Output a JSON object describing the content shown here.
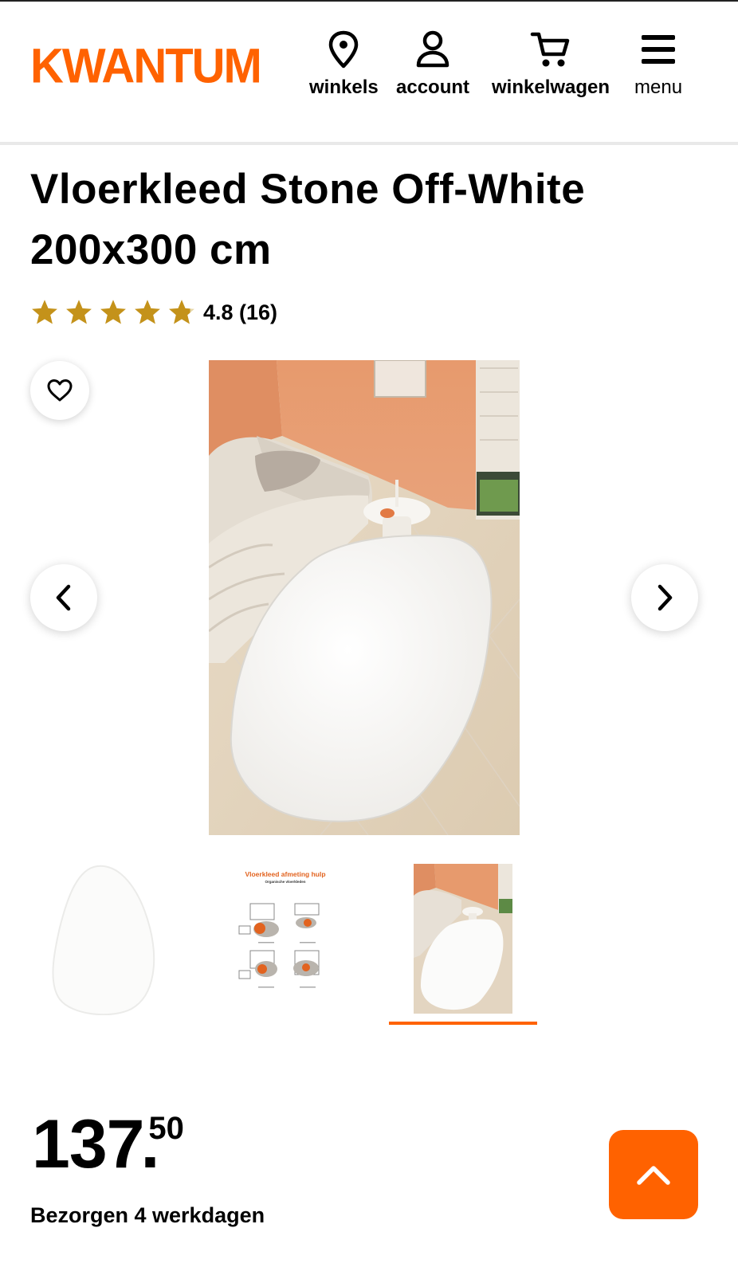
{
  "header": {
    "logo": "KWANTUM",
    "nav": [
      {
        "label": "winkels",
        "icon": "location-pin-icon"
      },
      {
        "label": "account",
        "icon": "user-icon"
      },
      {
        "label": "winkelwagen",
        "icon": "cart-icon"
      },
      {
        "label": "menu",
        "icon": "hamburger-icon"
      }
    ]
  },
  "product": {
    "title": "Vloerkleed Stone Off-White 200x300 cm",
    "rating_text": "4.8 (16)",
    "rating_value": 4.8,
    "rating_max": 5,
    "price": {
      "integer": "137",
      "separator": ".",
      "decimals": "50"
    },
    "delivery": "Bezorgen 4 werkdagen"
  },
  "gallery": {
    "active_index": 2,
    "thumbnail_chart": {
      "title": "Vloerkleed afmeting hulp",
      "subtitle": "Organische vloerkleden"
    }
  },
  "colors": {
    "brand": "#ff6200",
    "star": "#c4921a"
  }
}
